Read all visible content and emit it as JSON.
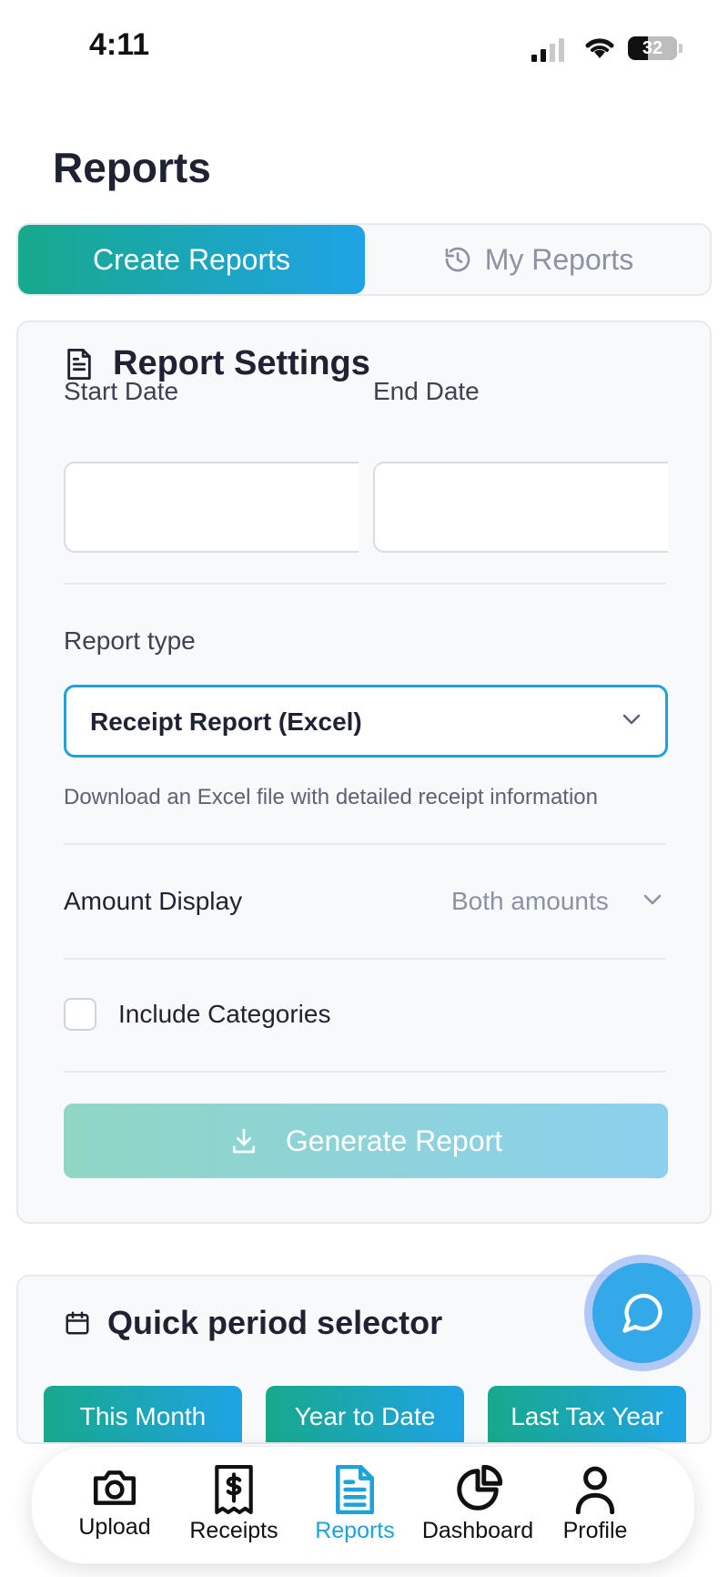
{
  "status_bar": {
    "time": "4:11",
    "battery": "32"
  },
  "page": {
    "title": "Reports"
  },
  "tabs": {
    "create": "Create Reports",
    "mine": "My Reports"
  },
  "settings": {
    "title": "Report Settings",
    "start_date_label": "Start Date",
    "start_date_value": "",
    "end_date_label": "End Date",
    "end_date_value": "",
    "report_type_label": "Report type",
    "report_type_value": "Receipt Report (Excel)",
    "report_type_help": "Download an Excel file with detailed receipt information",
    "amount_display_label": "Amount Display",
    "amount_display_value": "Both amounts",
    "include_categories_label": "Include Categories",
    "include_categories_checked": false,
    "generate_label": "Generate Report"
  },
  "quick_period": {
    "title": "Quick period selector",
    "options": [
      "This Month",
      "Year to Date",
      "Last Tax Year"
    ]
  },
  "nav": {
    "items": [
      {
        "label": "Upload",
        "icon": "camera-icon"
      },
      {
        "label": "Receipts",
        "icon": "receipt-icon"
      },
      {
        "label": "Reports",
        "icon": "document-icon",
        "active": true
      },
      {
        "label": "Dashboard",
        "icon": "pie-chart-icon"
      },
      {
        "label": "Profile",
        "icon": "user-icon"
      }
    ]
  },
  "colors": {
    "accent_teal": "#17a98c",
    "accent_blue": "#1fa3e6",
    "active_nav": "#1ea2dc"
  }
}
